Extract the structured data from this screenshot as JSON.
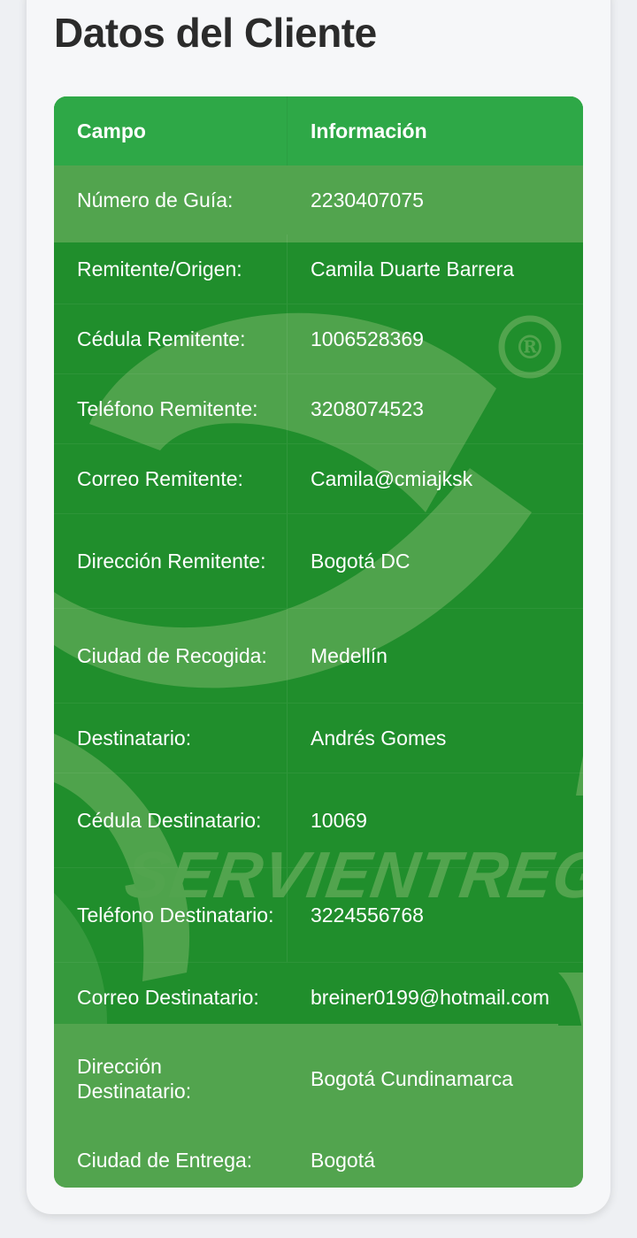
{
  "page": {
    "title": "Datos del Cliente"
  },
  "colors": {
    "header_row": "#2ea847",
    "light_row": "#52a44e",
    "dark_row": "#208e2c",
    "watermark": "#52a44e"
  },
  "watermark": {
    "logo_text": "SERVIENTREGA",
    "mark": "®"
  },
  "table": {
    "headers": [
      "Campo",
      "Información"
    ],
    "rows": [
      {
        "label": "Número de Guía:",
        "value": "2230407075"
      },
      {
        "label": "Remitente/Origen:",
        "value": "Camila Duarte Barrera"
      },
      {
        "label": "Cédula Remitente:",
        "value": "1006528369"
      },
      {
        "label": "Teléfono Remitente:",
        "value": "3208074523"
      },
      {
        "label": "Correo Remitente:",
        "value": "Camila@cmiajksk"
      },
      {
        "label": "Dirección Remitente:",
        "value": "Bogotá DC"
      },
      {
        "label": "Ciudad de Recogida:",
        "value": "Medellín"
      },
      {
        "label": "Destinatario:",
        "value": "Andrés Gomes"
      },
      {
        "label": "Cédula Destinatario:",
        "value": "10069"
      },
      {
        "label": "Teléfono Destinatario:",
        "value": "3224556768"
      },
      {
        "label": "Correo Destinatario:",
        "value": "breiner0199@hotmail.com"
      },
      {
        "label": "Dirección Destinatario:",
        "value": "Bogotá Cundinamarca"
      },
      {
        "label": "Ciudad de Entrega:",
        "value": "Bogotá"
      }
    ]
  }
}
